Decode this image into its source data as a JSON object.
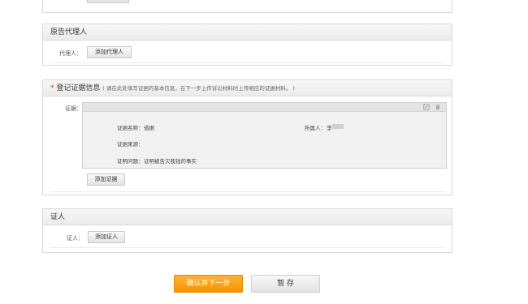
{
  "plaintiff_agent": {
    "title": "原告代理人",
    "agent_label": "代理人：",
    "add_agent_button": "添加代理人"
  },
  "evidence": {
    "required_mark": "*",
    "title": "登记证据信息",
    "hint": "( 请在此处填写证据的基本信息，在下一步上传诉讼材料时上传相应的证据材料。 )",
    "evidence_label": "证据：",
    "item": {
      "name_label": "证据名称：",
      "name_value": "借据",
      "source_label": "证据来源：",
      "source_value": "",
      "owner_label": "所属人：",
      "owner_value": "李",
      "purpose_label": "证明问题：",
      "purpose_value": "证明被告欠我钱的事实"
    },
    "add_evidence_button": "添加证据"
  },
  "witness": {
    "title": "证人",
    "witness_label": "证人：",
    "add_witness_button": "添加证人"
  },
  "actions": {
    "confirm_next": "确认并下一步",
    "save_draft": "暂 存"
  },
  "icons": {
    "edit": "edit-icon",
    "delete": "trash-icon"
  },
  "colors": {
    "primary": "#f39500",
    "required": "#e53935"
  }
}
